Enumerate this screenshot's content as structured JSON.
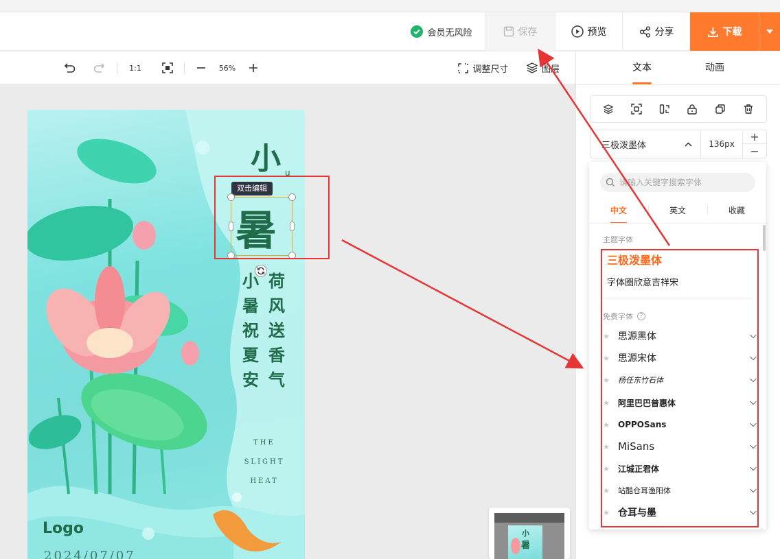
{
  "header": {
    "vip_label": "会员无风险",
    "save_label": "保存",
    "preview_label": "预览",
    "share_label": "分享",
    "download_label": "下载"
  },
  "toolbar": {
    "ratio_label": "1:1",
    "zoom_value": "56%",
    "resize_label": "调整尺寸",
    "layers_label": "图层"
  },
  "canvas": {
    "tooltip": "双击编辑",
    "poster": {
      "title_char_1": "小",
      "title_char_2": "暑",
      "title_small": "u",
      "poem_col_1": [
        "荷",
        "风",
        "送",
        "香",
        "气"
      ],
      "poem_col_2": [
        "小",
        "暑",
        "祝",
        "夏",
        "安"
      ],
      "english": [
        "THE",
        "SLIGHT",
        "HEAT"
      ],
      "logo": "Logo",
      "date": "2024/07/07"
    },
    "minimap": {
      "char_1": "小",
      "char_2": "暑"
    }
  },
  "right_panel": {
    "tabs": [
      "文本",
      "动画"
    ],
    "font_select_value": "三极泼墨体",
    "font_size_value": "136px",
    "stepper_plus": "+",
    "stepper_minus": "−"
  },
  "font_dropdown": {
    "search_placeholder": "请输入关键字搜索字体",
    "tabs": [
      "中文",
      "英文",
      "收藏"
    ],
    "section_theme": "主题字体",
    "theme_fonts": [
      "三极泼墨体",
      "字体圈欣意吉祥宋"
    ],
    "section_free": "免费字体",
    "help": "?",
    "free_fonts": [
      "思源黑体",
      "思源宋体",
      "杨任东竹石体",
      "阿里巴巴普惠体",
      "OPPOSans",
      "MiSans",
      "江城正君体",
      "站酷仓耳渔阳体",
      "仓耳与墨"
    ],
    "star": "★"
  },
  "colors": {
    "accent": "#ff7a2d",
    "annotation_red": "#e63535",
    "poster_text_green": "#1f6b4a",
    "selection_orange": "#f5a623"
  }
}
